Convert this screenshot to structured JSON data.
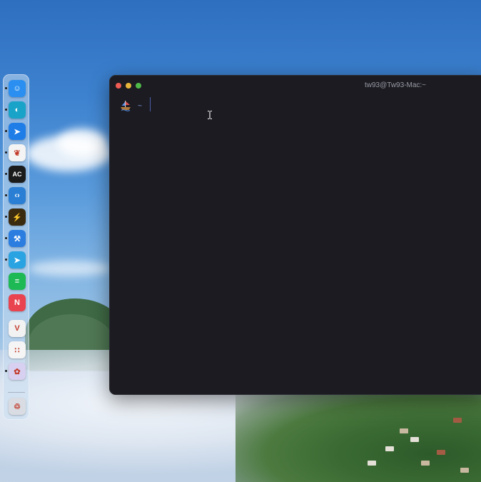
{
  "window": {
    "title": "tw93@Tw93-Mac:~"
  },
  "terminal": {
    "prompt_path": "~",
    "prompt_icon": "pirate-ship-icon"
  },
  "dock": {
    "items": [
      {
        "name": "finder",
        "icon": "finder-icon",
        "glyph": "☺",
        "color": "#2a8ff0",
        "running": true
      },
      {
        "name": "edge",
        "icon": "edge-icon",
        "glyph": "◐",
        "color": "#1aa3c8",
        "running": true
      },
      {
        "name": "paw",
        "icon": "paw-icon",
        "glyph": "➤",
        "color": "#1f7de8",
        "running": true
      },
      {
        "name": "cardinal",
        "icon": "bird-icon",
        "glyph": "❦",
        "color": "#f4f4f4",
        "running": true
      },
      {
        "name": "appcode",
        "icon": "appcode-icon",
        "glyph": "AC",
        "color": "#1b1b1b",
        "running": true
      },
      {
        "name": "vscode",
        "icon": "vscode-icon",
        "glyph": "‹›",
        "color": "#2a7fd4",
        "running": true
      },
      {
        "name": "terminal-app",
        "icon": "terminal-icon",
        "glyph": "⚡",
        "color": "#3a2a10",
        "running": true
      },
      {
        "name": "xcode",
        "icon": "xcode-icon",
        "glyph": "⚒",
        "color": "#2b7de0",
        "running": true
      },
      {
        "name": "telegram",
        "icon": "telegram-icon",
        "glyph": "➤",
        "color": "#2aa3e2",
        "running": true
      },
      {
        "name": "spotify",
        "icon": "spotify-icon",
        "glyph": "≡",
        "color": "#1db954",
        "running": false
      },
      {
        "name": "news",
        "icon": "news-icon",
        "glyph": "N",
        "color": "#e8434f",
        "running": false
      },
      {
        "name": "vmon",
        "icon": "v-logo-icon",
        "glyph": "V",
        "color": "#f2f2f2",
        "running": false
      },
      {
        "name": "launchpad",
        "icon": "launchpad-icon",
        "glyph": "∷",
        "color": "#f5f5f5",
        "running": false
      },
      {
        "name": "colors",
        "icon": "color-wheel-icon",
        "glyph": "✿",
        "color": "#d8d0f0",
        "running": true
      },
      {
        "name": "trash",
        "icon": "trash-icon",
        "glyph": "♲",
        "color": "#d9dde3",
        "running": false
      }
    ]
  }
}
